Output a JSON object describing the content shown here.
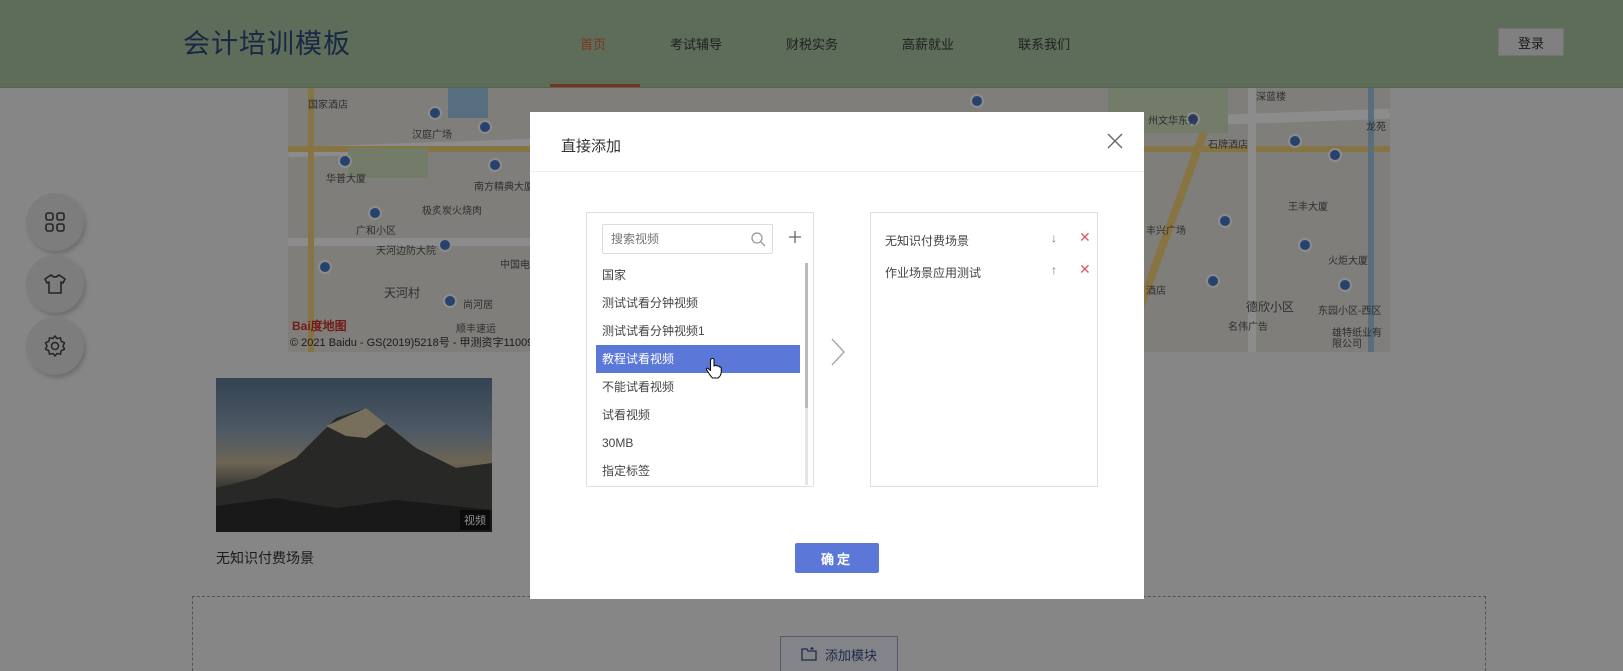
{
  "header": {
    "brand": "会计培训模板",
    "nav": [
      {
        "label": "首页",
        "active": true
      },
      {
        "label": "考试辅导",
        "active": false
      },
      {
        "label": "财税实务",
        "active": false
      },
      {
        "label": "高薪就业",
        "active": false
      },
      {
        "label": "联系我们",
        "active": false
      }
    ],
    "login_label": "登录"
  },
  "map": {
    "labels": [
      "国家酒店",
      "汉庭广场",
      "华普大厦",
      "南方精典大厦",
      "极炙炭火烧肉",
      "广和小区",
      "天河边防大院",
      "中国电",
      "天河村",
      "尚河居",
      "顺丰速运",
      "州文华东方",
      "石牌酒店",
      "深蓝楼",
      "王丰大厦",
      "丰兴广场",
      "火炬大厦",
      "酒店",
      "德欣小区",
      "东园小区-西区",
      "名伟广告",
      "雄特纸业有限公司",
      "龙苑"
    ],
    "logo_text": "Bai度地图",
    "copyright": "© 2021 Baidu - GS(2019)5218号 - 甲测资字11009"
  },
  "video_card": {
    "tag": "视频",
    "title": "无知识付费场景"
  },
  "add_module_label": "添加模块",
  "modal": {
    "title": "直接添加",
    "search_placeholder": "搜索视频",
    "list": [
      {
        "label": "国家",
        "selected": false
      },
      {
        "label": "测试试看分钟视频",
        "selected": false
      },
      {
        "label": "测试试看分钟视频1",
        "selected": false
      },
      {
        "label": "教程试看视频",
        "selected": true
      },
      {
        "label": "不能试看视频",
        "selected": false
      },
      {
        "label": "试看视频",
        "selected": false
      },
      {
        "label": "30MB",
        "selected": false
      },
      {
        "label": "指定标签",
        "selected": false
      }
    ],
    "selected_items": [
      {
        "label": "无知识付费场景",
        "move": "↓",
        "delete": "✕"
      },
      {
        "label": "作业场景应用测试",
        "move": "↑",
        "delete": "✕"
      }
    ],
    "confirm_label": "确定"
  },
  "colors": {
    "header_bg": "#a9c7a5",
    "accent": "#5b78d8",
    "nav_active": "#e6603a",
    "delete": "#e0566a"
  }
}
